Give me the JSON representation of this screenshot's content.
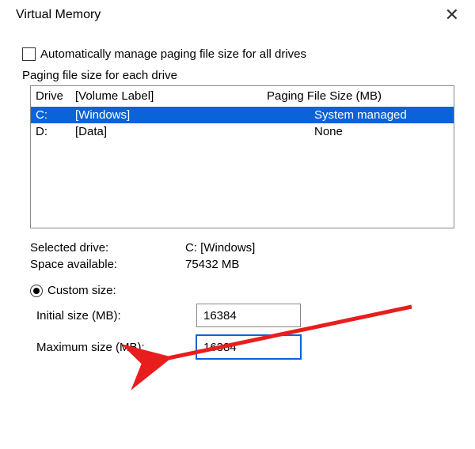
{
  "title": "Virtual Memory",
  "checkbox_label": "Automatically manage paging file size for all drives",
  "checkbox_checked": false,
  "section_label": "Paging file size for each drive",
  "header_drive": "Drive",
  "header_volume": "[Volume Label]",
  "header_size": "Paging File Size (MB)",
  "drives": [
    {
      "letter": "C:",
      "label": "[Windows]",
      "size": "System managed",
      "selected": true
    },
    {
      "letter": "D:",
      "label": "[Data]",
      "size": "None",
      "selected": false
    }
  ],
  "selected_drive_label": "Selected drive:",
  "selected_drive_value": "C:  [Windows]",
  "space_available_label": "Space available:",
  "space_available_value": "75432 MB",
  "custom_size_label": "Custom size:",
  "custom_size_checked": true,
  "initial_size_label": "Initial size (MB):",
  "initial_size_value": "16384",
  "maximum_size_label": "Maximum size (MB):",
  "maximum_size_value": "16384"
}
